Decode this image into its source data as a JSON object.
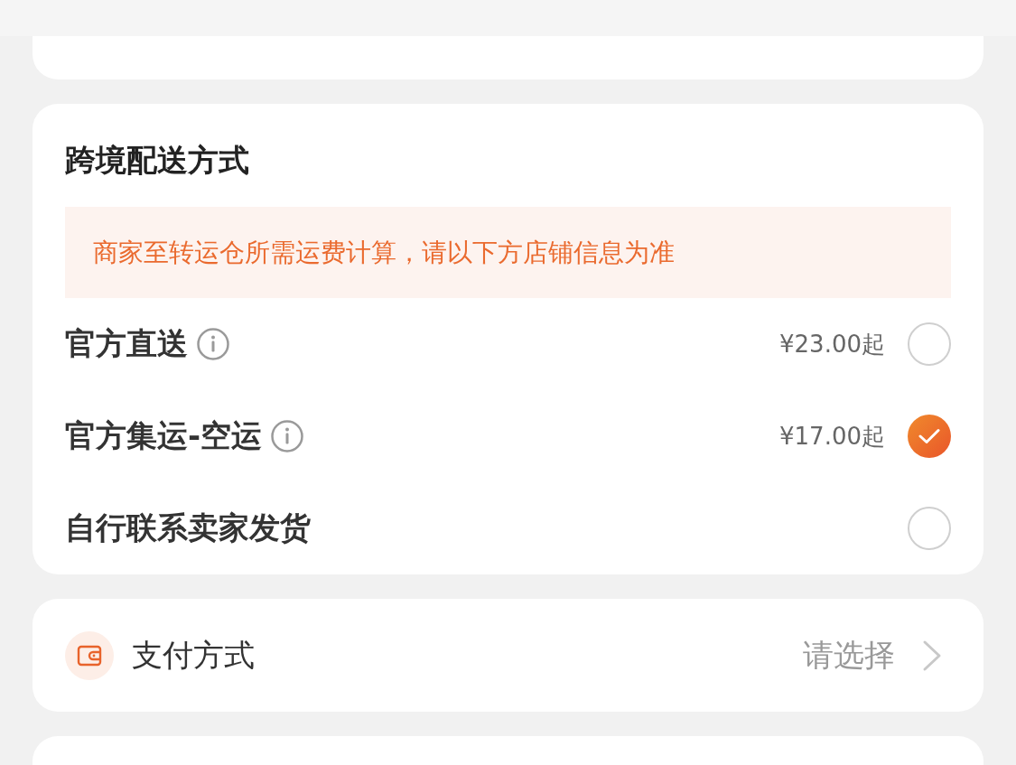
{
  "shipping": {
    "title": "跨境配送方式",
    "notice": "商家至转运仓所需运费计算，请以下方店铺信息为准",
    "options": [
      {
        "label": "官方直送",
        "info": true,
        "price": "¥23.00起",
        "selected": false
      },
      {
        "label": "官方集运-空运",
        "info": true,
        "price": "¥17.00起",
        "selected": true
      },
      {
        "label": "自行联系卖家发货",
        "info": false,
        "selected": false
      }
    ]
  },
  "payment": {
    "label": "支付方式",
    "value": "请选择"
  }
}
